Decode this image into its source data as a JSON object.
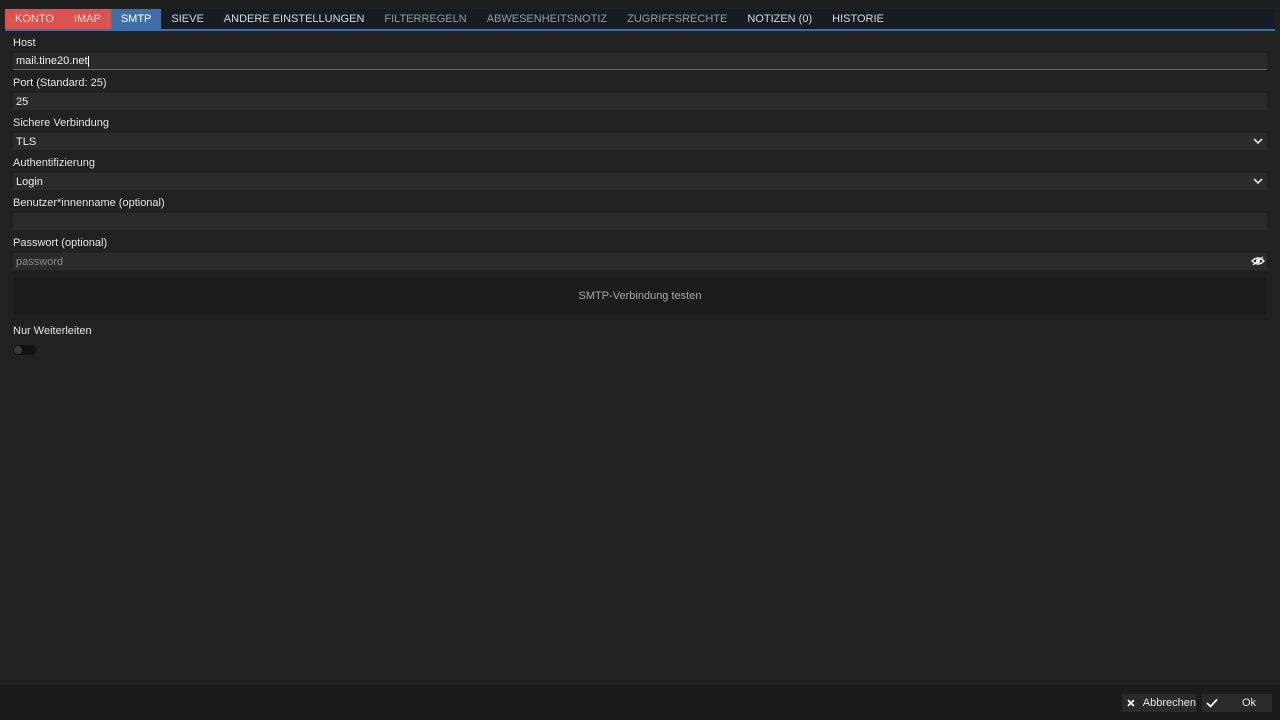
{
  "tabs": [
    {
      "label": "KONTO",
      "style": "red"
    },
    {
      "label": "IMAP",
      "style": "red"
    },
    {
      "label": "SMTP",
      "style": "active"
    },
    {
      "label": "SIEVE",
      "style": "normal"
    },
    {
      "label": "ANDERE EINSTELLUNGEN",
      "style": "normal"
    },
    {
      "label": "FILTERREGELN",
      "style": "dim"
    },
    {
      "label": "ABWESENHEITSNOTIZ",
      "style": "dim"
    },
    {
      "label": "ZUGRIFFSRECHTE",
      "style": "dim"
    },
    {
      "label": "NOTIZEN (0)",
      "style": "normal"
    },
    {
      "label": "HISTORIE",
      "style": "normal"
    }
  ],
  "form": {
    "host": {
      "label": "Host",
      "value": "mail.tine20.net"
    },
    "port": {
      "label": "Port (Standard: 25)",
      "value": "25"
    },
    "secure": {
      "label": "Sichere Verbindung",
      "value": "TLS"
    },
    "auth": {
      "label": "Authentifizierung",
      "value": "Login"
    },
    "username": {
      "label": "Benutzer*innenname (optional)",
      "value": ""
    },
    "password": {
      "label": "Passwort (optional)",
      "placeholder": "password"
    },
    "test_button": "SMTP-Verbindung testen",
    "forward_only": {
      "label": "Nur Weiterleiten",
      "enabled": false
    }
  },
  "footer": {
    "cancel_label": "Abbrechen",
    "ok_label": "Ok"
  },
  "colors": {
    "accent": "#3f6fa6",
    "error_tab": "#d9534f",
    "background": "#212121"
  },
  "icons": {
    "select": "chevron-down-icon",
    "password": "eye-icon",
    "cancel": "close-icon",
    "ok": "check-icon"
  }
}
